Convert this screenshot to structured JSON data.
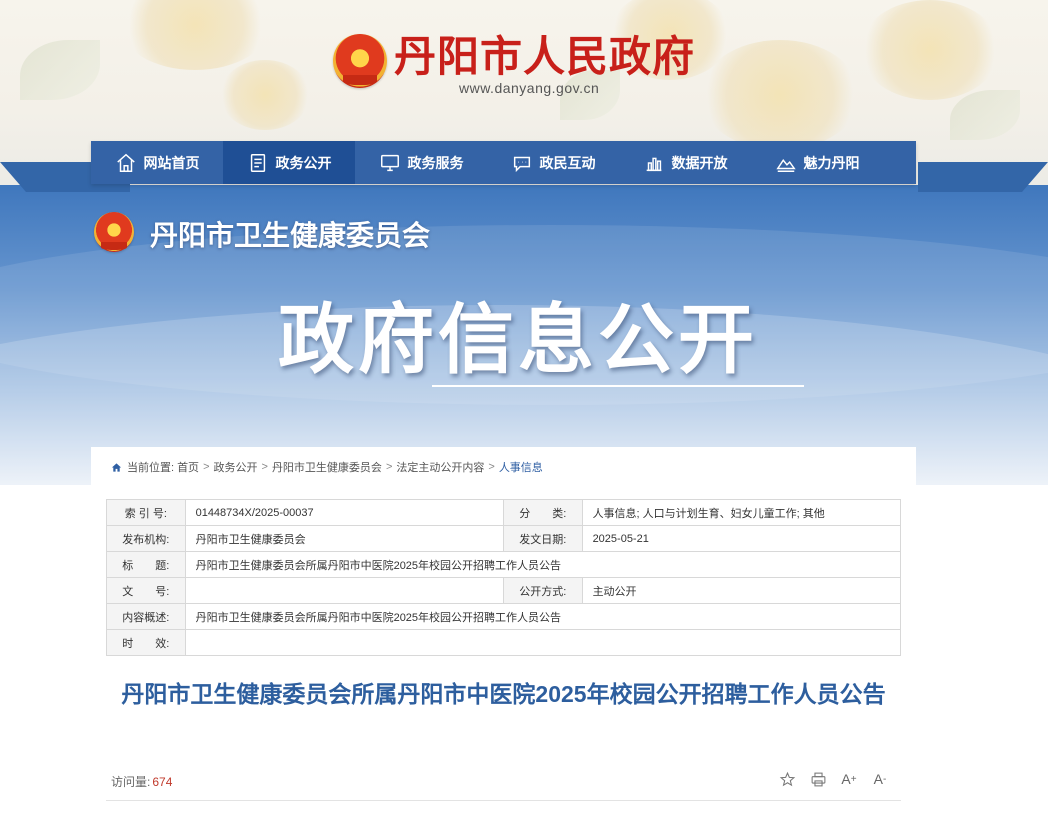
{
  "site": {
    "title": "丹阳市人民政府",
    "url": "www.danyang.gov.cn"
  },
  "nav": {
    "items": [
      {
        "label": "网站首页",
        "icon": "home-icon"
      },
      {
        "label": "政务公开",
        "icon": "document-icon",
        "active": true
      },
      {
        "label": "政务服务",
        "icon": "monitor-icon"
      },
      {
        "label": "政民互动",
        "icon": "chat-icon"
      },
      {
        "label": "数据开放",
        "icon": "chart-icon"
      },
      {
        "label": "魅力丹阳",
        "icon": "landscape-icon"
      }
    ]
  },
  "department": {
    "title": "丹阳市卫生健康委员会"
  },
  "hero": {
    "title": "政府信息公开"
  },
  "breadcrumb": {
    "prefix": "当前位置:",
    "items": [
      "首页",
      "政务公开",
      "丹阳市卫生健康委员会",
      "法定主动公开内容",
      "人事信息"
    ],
    "separator": ">"
  },
  "meta": {
    "index_label": "索 引 号:",
    "index_value": "01448734X/2025-00037",
    "category_label": "分　　类:",
    "category_value": "人事信息;  人口与计划生育、妇女儿童工作;  其他",
    "publisher_label": "发布机构:",
    "publisher_value": "丹阳市卫生健康委员会",
    "date_label": "发文日期:",
    "date_value": "2025-05-21",
    "title_label": "标　　题:",
    "title_value": "丹阳市卫生健康委员会所属丹阳市中医院2025年校园公开招聘工作人员公告",
    "docno_label": "文　　号:",
    "docno_value": "",
    "method_label": "公开方式:",
    "method_value": "主动公开",
    "summary_label": "内容概述:",
    "summary_value": "丹阳市卫生健康委员会所属丹阳市中医院2025年校园公开招聘工作人员公告",
    "validity_label": "时　　效:",
    "validity_value": ""
  },
  "article": {
    "title": "丹阳市卫生健康委员会所属丹阳市中医院2025年校园公开招聘工作人员公告",
    "visits_label": "访问量:",
    "visits_value": "674"
  },
  "tools": {
    "font_increase": "A",
    "font_increase_sup": "+",
    "font_decrease": "A",
    "font_decrease_sup": "-"
  },
  "colors": {
    "nav_bg": "#3463a6",
    "nav_active": "#1f4f95",
    "site_title": "#c8201a",
    "article_title": "#2d5e9e"
  }
}
